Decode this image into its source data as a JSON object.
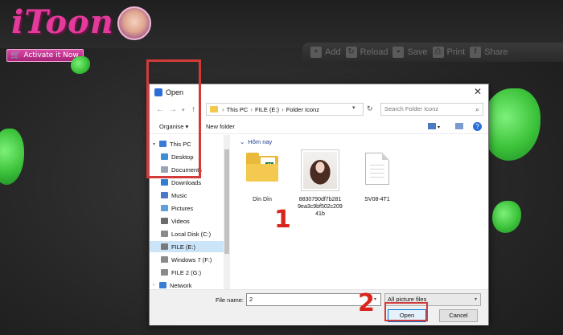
{
  "app": {
    "logo": "iToon",
    "activate_label": "Activate it Now",
    "toolbar": [
      {
        "label": "Add",
        "icon": "add-photo-icon"
      },
      {
        "label": "Reload",
        "icon": "reload-icon"
      },
      {
        "label": "Save",
        "icon": "save-icon"
      },
      {
        "label": "Print",
        "icon": "print-icon"
      },
      {
        "label": "Share",
        "icon": "facebook-icon"
      }
    ]
  },
  "dialog": {
    "title": "Open",
    "address": {
      "segments": [
        "This PC",
        "FILE (E:)",
        "Folder Iconz"
      ]
    },
    "search_placeholder": "Search Folder Iconz",
    "commands": {
      "organise": "Organise",
      "new_folder": "New folder"
    },
    "nav": [
      {
        "label": "This PC",
        "icon": "computer-icon"
      },
      {
        "label": "Desktop",
        "icon": "desktop-icon"
      },
      {
        "label": "Documents",
        "icon": "documents-icon"
      },
      {
        "label": "Downloads",
        "icon": "downloads-icon"
      },
      {
        "label": "Music",
        "icon": "music-icon"
      },
      {
        "label": "Pictures",
        "icon": "pictures-icon"
      },
      {
        "label": "Videos",
        "icon": "videos-icon"
      },
      {
        "label": "Local Disk (C:)",
        "icon": "drive-icon"
      },
      {
        "label": "FILE (E:)",
        "icon": "drive-icon",
        "selected": true
      },
      {
        "label": "Windows 7 (F:)",
        "icon": "drive-icon"
      },
      {
        "label": "FILE 2 (G:)",
        "icon": "drive-icon"
      },
      {
        "label": "Network",
        "icon": "network-icon"
      }
    ],
    "group_header": "Hôm nay",
    "files": [
      {
        "name": "Dìn Dìn",
        "type": "folder"
      },
      {
        "name_lines": [
          "8830790df7b281",
          "9ea3c9bf502c209",
          "41b"
        ],
        "type": "image"
      },
      {
        "name": "SV08-4T1",
        "type": "document"
      }
    ],
    "file_name_label": "File name:",
    "file_name_value": "2",
    "file_type": "All picture files",
    "open_label": "Open",
    "cancel_label": "Cancel"
  },
  "annotations": {
    "step1": "1",
    "step2": "2",
    "highlight_color": "#d43a3a"
  }
}
